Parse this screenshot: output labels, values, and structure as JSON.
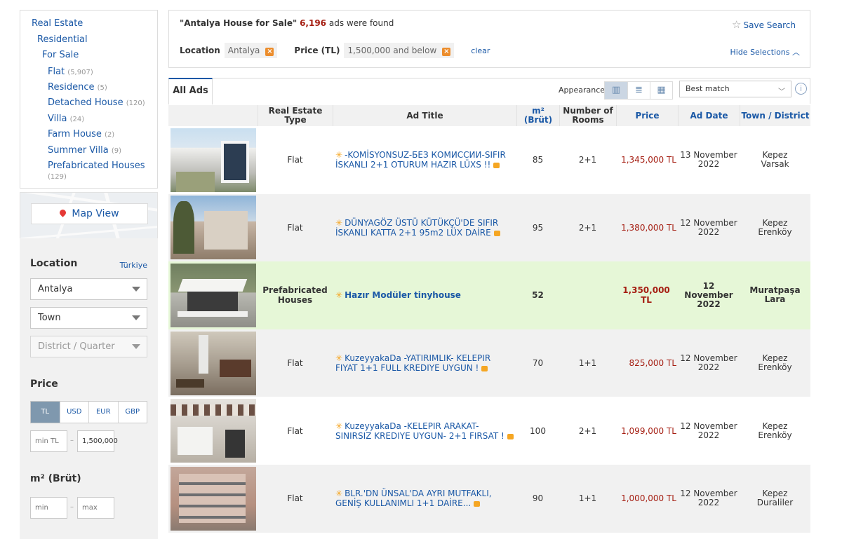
{
  "categories": {
    "root": "Real Estate",
    "level1": "Residential",
    "level2": "For Sale",
    "items": [
      {
        "label": "Flat",
        "count": "(5,907)"
      },
      {
        "label": "Residence",
        "count": "(5)"
      },
      {
        "label": "Detached House",
        "count": "(120)"
      },
      {
        "label": "Villa",
        "count": "(24)"
      },
      {
        "label": "Farm House",
        "count": "(2)"
      },
      {
        "label": "Summer Villa",
        "count": "(9)"
      },
      {
        "label": "Prefabricated Houses",
        "count": "(129)"
      }
    ]
  },
  "map": {
    "label": "Map View"
  },
  "location": {
    "title": "Location",
    "country": "Türkiye",
    "city": "Antalya",
    "town": "Town",
    "district": "District / Quarter"
  },
  "price": {
    "title": "Price",
    "currencies": [
      "TL",
      "USD",
      "EUR",
      "GBP"
    ],
    "min_placeholder": "min TL",
    "max_value": "1,500,000"
  },
  "area": {
    "title": "m² (Brüt)",
    "min_placeholder": "min",
    "max_placeholder": "max"
  },
  "summary": {
    "query": "\"Antalya House for Sale\"",
    "count": "6,196",
    "suffix": "ads were found",
    "save": "Save Search",
    "location_label": "Location",
    "location_value": "Antalya",
    "price_label": "Price (TL)",
    "price_value": "1,500,000 and below",
    "clear": "clear",
    "hide": "Hide Selections"
  },
  "toolbar": {
    "tab": "All Ads",
    "appearance": "Appearance",
    "sort": "Best match",
    "info": "i"
  },
  "columns": [
    "Real Estate Type",
    "Ad Title",
    "m² (Brüt)",
    "Number of Rooms",
    "Price",
    "Ad Date",
    "Town / District"
  ],
  "listings": [
    {
      "type": "Flat",
      "title": "-KOMİSYONSUZ-БЕЗ КОМИССИИ-SIFIR İSKANLI 2+1 OTURUM HAZIR LÜXS !!",
      "m2": "85",
      "rooms": "2+1",
      "price": "1,345,000 TL",
      "date": "13 November 2022",
      "town": "Kepez",
      "district": "Varsak"
    },
    {
      "type": "Flat",
      "title": "DÜNYAGÖZ ÜSTÜ KÜTÜKÇÜ'DE SIFIR İSKANLI KATTA 2+1 95m2 LÜX DAİRE",
      "m2": "95",
      "rooms": "2+1",
      "price": "1,380,000 TL",
      "date": "12 November 2022",
      "town": "Kepez",
      "district": "Erenköy"
    },
    {
      "type": "Prefabricated Houses",
      "title": "Hazır Modüler tinyhouse",
      "m2": "52",
      "rooms": "",
      "price": "1,350,000 TL",
      "date": "12 November 2022",
      "town": "Muratpaşa",
      "district": "Lara"
    },
    {
      "type": "Flat",
      "title": "KuzeyyakaDa -YATIRIMLIK- KELEPIR FIYAT 1+1 FULL KREDIYE UYGUN !",
      "m2": "70",
      "rooms": "1+1",
      "price": "825,000 TL",
      "date": "12 November 2022",
      "town": "Kepez",
      "district": "Erenköy"
    },
    {
      "type": "Flat",
      "title": "KuzeyyakaDa -KELEPIR ARAKAT-SINIRSIZ KREDIYE UYGUN- 2+1 FIRSAT !",
      "m2": "100",
      "rooms": "2+1",
      "price": "1,099,000 TL",
      "date": "12 November 2022",
      "town": "Kepez",
      "district": "Erenköy"
    },
    {
      "type": "Flat",
      "title": "BLR.'DN ÜNSAL'DA AYRI MUTFAKLI, GENİŞ KULLANIMLI 1+1 DAİRE...",
      "m2": "90",
      "rooms": "1+1",
      "price": "1,000,000 TL",
      "date": "12 November 2022",
      "town": "Kepez",
      "district": "Duraliler"
    }
  ]
}
